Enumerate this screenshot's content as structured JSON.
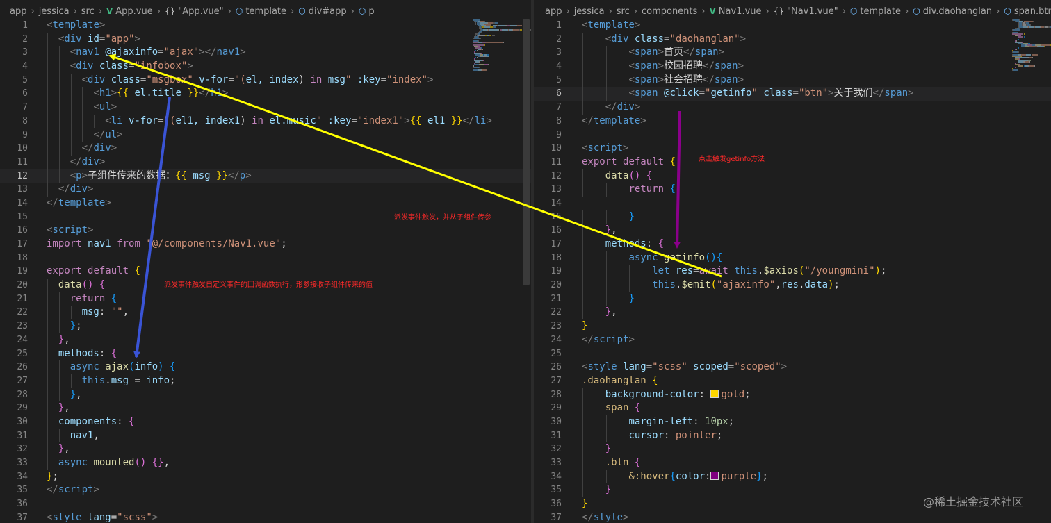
{
  "colors": {
    "editor_bg": "#1e1e1e",
    "tag": "#569cd6",
    "punctuation": "#808080",
    "attribute": "#9cdcfe",
    "string": "#ce9178",
    "keyword": "#c586c0",
    "function": "#dcdcaa",
    "selector": "#d7ba7d",
    "property": "#9cdcfe",
    "number": "#b5cea8",
    "brace_yellow": "#ffd700",
    "brace_purple": "#da70d6",
    "brace_blue": "#179fff",
    "annotation": "#ff2a2a",
    "arrow_yellow": "#ffff00",
    "arrow_blue": "#3a54d6",
    "arrow_purple": "#8b008b",
    "swatch_gold": "#ffd700",
    "swatch_purple": "#800080"
  },
  "left_breadcrumb": [
    {
      "label": "app",
      "icon": ""
    },
    {
      "label": "jessica",
      "icon": ""
    },
    {
      "label": "src",
      "icon": ""
    },
    {
      "label": "App.vue",
      "icon": "vue-file-icon"
    },
    {
      "label": "\"App.vue\"",
      "icon": "braces-icon"
    },
    {
      "label": "template",
      "icon": "cube-icon"
    },
    {
      "label": "div#app",
      "icon": "cube-icon"
    },
    {
      "label": "p",
      "icon": "cube-icon"
    }
  ],
  "right_breadcrumb": [
    {
      "label": "app",
      "icon": ""
    },
    {
      "label": "jessica",
      "icon": ""
    },
    {
      "label": "src",
      "icon": ""
    },
    {
      "label": "components",
      "icon": ""
    },
    {
      "label": "Nav1.vue",
      "icon": "vue-file-icon"
    },
    {
      "label": "\"Nav1.vue\"",
      "icon": "braces-icon"
    },
    {
      "label": "template",
      "icon": "cube-icon"
    },
    {
      "label": "div.daohanglan",
      "icon": "cube-icon"
    },
    {
      "label": "span.btn",
      "icon": "cube-icon"
    }
  ],
  "left_current_line": 12,
  "right_current_line": 6,
  "left_code": [
    [
      [
        "<",
        "p"
      ],
      [
        "template",
        "t"
      ],
      [
        ">",
        "p"
      ]
    ],
    [
      [
        "  ",
        "d"
      ],
      [
        "<",
        "p"
      ],
      [
        "div ",
        "t"
      ],
      [
        "id",
        "a"
      ],
      [
        "=",
        "d"
      ],
      [
        "\"app\"",
        "s"
      ],
      [
        ">",
        "p"
      ]
    ],
    [
      [
        "    ",
        "d"
      ],
      [
        "<",
        "p"
      ],
      [
        "nav1 ",
        "t"
      ],
      [
        "@ajaxinfo",
        "a"
      ],
      [
        "=",
        "d"
      ],
      [
        "\"ajax\"",
        "s"
      ],
      [
        "></",
        "p"
      ],
      [
        "nav1",
        "t"
      ],
      [
        ">",
        "p"
      ]
    ],
    [
      [
        "    ",
        "d"
      ],
      [
        "<",
        "p"
      ],
      [
        "div ",
        "t"
      ],
      [
        "class",
        "a"
      ],
      [
        "=",
        "d"
      ],
      [
        "\"infobox\"",
        "s"
      ],
      [
        ">",
        "p"
      ]
    ],
    [
      [
        "      ",
        "d"
      ],
      [
        "<",
        "p"
      ],
      [
        "div ",
        "t"
      ],
      [
        "class",
        "a"
      ],
      [
        "=",
        "d"
      ],
      [
        "\"msgbox\"",
        "s"
      ],
      [
        " ",
        "d"
      ],
      [
        "v-for",
        "a"
      ],
      [
        "=",
        "d"
      ],
      [
        "\"(",
        "s"
      ],
      [
        "el, ",
        "a"
      ],
      [
        "index",
        "a"
      ],
      [
        ") ",
        "d"
      ],
      [
        "in ",
        "k"
      ],
      [
        "msg",
        "a"
      ],
      [
        "\"",
        "s"
      ],
      [
        " :key",
        "a"
      ],
      [
        "=",
        "d"
      ],
      [
        "\"index\"",
        "s"
      ],
      [
        ">",
        "p"
      ]
    ],
    [
      [
        "        ",
        "d"
      ],
      [
        "<",
        "p"
      ],
      [
        "h1",
        "t"
      ],
      [
        ">",
        "p"
      ],
      [
        "{{ ",
        "y"
      ],
      [
        "el.title",
        "a"
      ],
      [
        " }}",
        "y"
      ],
      [
        "</",
        "p"
      ],
      [
        "h1",
        "t"
      ],
      [
        ">",
        "p"
      ]
    ],
    [
      [
        "        ",
        "d"
      ],
      [
        "<",
        "p"
      ],
      [
        "ul",
        "t"
      ],
      [
        ">",
        "p"
      ]
    ],
    [
      [
        "          ",
        "d"
      ],
      [
        "<",
        "p"
      ],
      [
        "li ",
        "t"
      ],
      [
        "v-for",
        "a"
      ],
      [
        "=",
        "d"
      ],
      [
        "\"(",
        "s"
      ],
      [
        "el1, index1",
        "a"
      ],
      [
        ") ",
        "d"
      ],
      [
        "in ",
        "k"
      ],
      [
        "el.music",
        "a"
      ],
      [
        "\"",
        "s"
      ],
      [
        " :key",
        "a"
      ],
      [
        "=",
        "d"
      ],
      [
        "\"index1\"",
        "s"
      ],
      [
        ">",
        "p"
      ],
      [
        "{{ ",
        "y"
      ],
      [
        "el1",
        "a"
      ],
      [
        " }}",
        "y"
      ],
      [
        "</",
        "p"
      ],
      [
        "li",
        "t"
      ],
      [
        ">",
        "p"
      ]
    ],
    [
      [
        "        ",
        "d"
      ],
      [
        "</",
        "p"
      ],
      [
        "ul",
        "t"
      ],
      [
        ">",
        "p"
      ]
    ],
    [
      [
        "      ",
        "d"
      ],
      [
        "</",
        "p"
      ],
      [
        "div",
        "t"
      ],
      [
        ">",
        "p"
      ]
    ],
    [
      [
        "    ",
        "d"
      ],
      [
        "</",
        "p"
      ],
      [
        "div",
        "t"
      ],
      [
        ">",
        "p"
      ]
    ],
    [
      [
        "    ",
        "d"
      ],
      [
        "<",
        "p"
      ],
      [
        "p",
        "t"
      ],
      [
        ">",
        "p"
      ],
      [
        "子组件传来的数据：",
        "d"
      ],
      [
        "{{ ",
        "y"
      ],
      [
        "msg",
        "a"
      ],
      [
        " }}",
        "y"
      ],
      [
        "</",
        "p"
      ],
      [
        "p",
        "t"
      ],
      [
        ">",
        "p"
      ]
    ],
    [
      [
        "  ",
        "d"
      ],
      [
        "</",
        "p"
      ],
      [
        "div",
        "t"
      ],
      [
        ">",
        "p"
      ]
    ],
    [
      [
        "</",
        "p"
      ],
      [
        "template",
        "t"
      ],
      [
        ">",
        "p"
      ]
    ],
    [],
    [
      [
        "<",
        "p"
      ],
      [
        "script",
        "t"
      ],
      [
        ">",
        "p"
      ]
    ],
    [
      [
        "import ",
        "k"
      ],
      [
        "nav1 ",
        "a"
      ],
      [
        "from ",
        "k"
      ],
      [
        "\"@/components/Nav1.vue\"",
        "s"
      ],
      [
        ";",
        "d"
      ]
    ],
    [],
    [
      [
        "export ",
        "k"
      ],
      [
        "default ",
        "k"
      ],
      [
        "{",
        "y"
      ]
    ],
    [
      [
        "  ",
        "d"
      ],
      [
        "data",
        "f"
      ],
      [
        "() ",
        "m"
      ],
      [
        "{",
        "m"
      ]
    ],
    [
      [
        "    ",
        "d"
      ],
      [
        "return ",
        "k"
      ],
      [
        "{",
        "b"
      ]
    ],
    [
      [
        "      ",
        "d"
      ],
      [
        "msg",
        "a"
      ],
      [
        ": ",
        "d"
      ],
      [
        "\"\"",
        "s"
      ],
      [
        ",",
        "d"
      ]
    ],
    [
      [
        "    ",
        "d"
      ],
      [
        "}",
        "b"
      ],
      [
        ";",
        "d"
      ]
    ],
    [
      [
        "  ",
        "d"
      ],
      [
        "}",
        "m"
      ],
      [
        ",",
        "d"
      ]
    ],
    [
      [
        "  ",
        "d"
      ],
      [
        "methods",
        "a"
      ],
      [
        ": ",
        "d"
      ],
      [
        "{",
        "m"
      ]
    ],
    [
      [
        "    ",
        "d"
      ],
      [
        "async ",
        "t"
      ],
      [
        "ajax",
        "f"
      ],
      [
        "(",
        "b"
      ],
      [
        "info",
        "a"
      ],
      [
        ") ",
        "b"
      ],
      [
        "{",
        "b"
      ]
    ],
    [
      [
        "      ",
        "d"
      ],
      [
        "this",
        "t"
      ],
      [
        ".",
        "d"
      ],
      [
        "msg",
        "a"
      ],
      [
        " = ",
        "d"
      ],
      [
        "info",
        "a"
      ],
      [
        ";",
        "d"
      ]
    ],
    [
      [
        "    ",
        "d"
      ],
      [
        "}",
        "b"
      ],
      [
        ",",
        "d"
      ]
    ],
    [
      [
        "  ",
        "d"
      ],
      [
        "}",
        "m"
      ],
      [
        ",",
        "d"
      ]
    ],
    [
      [
        "  ",
        "d"
      ],
      [
        "components",
        "a"
      ],
      [
        ": ",
        "d"
      ],
      [
        "{",
        "m"
      ]
    ],
    [
      [
        "    ",
        "d"
      ],
      [
        "nav1",
        "a"
      ],
      [
        ",",
        "d"
      ]
    ],
    [
      [
        "  ",
        "d"
      ],
      [
        "}",
        "m"
      ],
      [
        ",",
        "d"
      ]
    ],
    [
      [
        "  ",
        "d"
      ],
      [
        "async ",
        "t"
      ],
      [
        "mounted",
        "f"
      ],
      [
        "() ",
        "m"
      ],
      [
        "{}",
        "m"
      ],
      [
        ",",
        "d"
      ]
    ],
    [
      [
        "}",
        "y"
      ],
      [
        ";",
        "d"
      ]
    ],
    [
      [
        "</",
        "p"
      ],
      [
        "script",
        "t"
      ],
      [
        ">",
        "p"
      ]
    ],
    [],
    [
      [
        "<",
        "p"
      ],
      [
        "style ",
        "t"
      ],
      [
        "lang",
        "a"
      ],
      [
        "=",
        "d"
      ],
      [
        "\"scss\"",
        "s"
      ],
      [
        ">",
        "p"
      ]
    ]
  ],
  "right_code": [
    [
      [
        "<",
        "p"
      ],
      [
        "template",
        "t"
      ],
      [
        ">",
        "p"
      ]
    ],
    [
      [
        "    ",
        "d"
      ],
      [
        "<",
        "p"
      ],
      [
        "div ",
        "t"
      ],
      [
        "class",
        "a"
      ],
      [
        "=",
        "d"
      ],
      [
        "\"daohanglan\"",
        "s"
      ],
      [
        ">",
        "p"
      ]
    ],
    [
      [
        "        ",
        "d"
      ],
      [
        "<",
        "p"
      ],
      [
        "span",
        "t"
      ],
      [
        ">",
        "p"
      ],
      [
        "首页",
        "d"
      ],
      [
        "</",
        "p"
      ],
      [
        "span",
        "t"
      ],
      [
        ">",
        "p"
      ]
    ],
    [
      [
        "        ",
        "d"
      ],
      [
        "<",
        "p"
      ],
      [
        "span",
        "t"
      ],
      [
        ">",
        "p"
      ],
      [
        "校园招聘",
        "d"
      ],
      [
        "</",
        "p"
      ],
      [
        "span",
        "t"
      ],
      [
        ">",
        "p"
      ]
    ],
    [
      [
        "        ",
        "d"
      ],
      [
        "<",
        "p"
      ],
      [
        "span",
        "t"
      ],
      [
        ">",
        "p"
      ],
      [
        "社会招聘",
        "d"
      ],
      [
        "</",
        "p"
      ],
      [
        "span",
        "t"
      ],
      [
        ">",
        "p"
      ]
    ],
    [
      [
        "        ",
        "d"
      ],
      [
        "<",
        "p"
      ],
      [
        "span ",
        "t"
      ],
      [
        "@click",
        "a"
      ],
      [
        "=",
        "d"
      ],
      [
        "\"",
        "s"
      ],
      [
        "getinfo",
        "a"
      ],
      [
        "\"",
        "s"
      ],
      [
        " class",
        "a"
      ],
      [
        "=",
        "d"
      ],
      [
        "\"btn\"",
        "s"
      ],
      [
        ">",
        "p"
      ],
      [
        "关于我们",
        "d"
      ],
      [
        "</",
        "p"
      ],
      [
        "span",
        "t"
      ],
      [
        ">",
        "p"
      ]
    ],
    [
      [
        "    ",
        "d"
      ],
      [
        "</",
        "p"
      ],
      [
        "div",
        "t"
      ],
      [
        ">",
        "p"
      ]
    ],
    [
      [
        "</",
        "p"
      ],
      [
        "template",
        "t"
      ],
      [
        ">",
        "p"
      ]
    ],
    [],
    [
      [
        "<",
        "p"
      ],
      [
        "script",
        "t"
      ],
      [
        ">",
        "p"
      ]
    ],
    [
      [
        "export ",
        "k"
      ],
      [
        "default ",
        "k"
      ],
      [
        "{",
        "y"
      ]
    ],
    [
      [
        "    ",
        "d"
      ],
      [
        "data",
        "f"
      ],
      [
        "() ",
        "m"
      ],
      [
        "{",
        "m"
      ]
    ],
    [
      [
        "        ",
        "d"
      ],
      [
        "return ",
        "k"
      ],
      [
        "{",
        "b"
      ]
    ],
    [],
    [
      [
        "        ",
        "d"
      ],
      [
        "}",
        "b"
      ]
    ],
    [
      [
        "    ",
        "d"
      ],
      [
        "}",
        "m"
      ],
      [
        ",",
        "d"
      ]
    ],
    [
      [
        "    ",
        "d"
      ],
      [
        "methods",
        "a"
      ],
      [
        ": ",
        "d"
      ],
      [
        "{",
        "m"
      ]
    ],
    [
      [
        "        ",
        "d"
      ],
      [
        "async ",
        "t"
      ],
      [
        "getinfo",
        "f"
      ],
      [
        "()",
        "b"
      ],
      [
        "{",
        "b"
      ]
    ],
    [
      [
        "            ",
        "d"
      ],
      [
        "let ",
        "t"
      ],
      [
        "res",
        "a"
      ],
      [
        "=",
        "d"
      ],
      [
        "await ",
        "k"
      ],
      [
        "this",
        "t"
      ],
      [
        ".",
        "d"
      ],
      [
        "$axios",
        "f"
      ],
      [
        "(",
        "y"
      ],
      [
        "\"/youngmini\"",
        "s"
      ],
      [
        ")",
        "y"
      ],
      [
        ";",
        "d"
      ]
    ],
    [
      [
        "            ",
        "d"
      ],
      [
        "this",
        "t"
      ],
      [
        ".",
        "d"
      ],
      [
        "$emit",
        "f"
      ],
      [
        "(",
        "y"
      ],
      [
        "\"ajaxinfo\"",
        "s"
      ],
      [
        ",",
        "d"
      ],
      [
        "res",
        "a"
      ],
      [
        ".",
        "d"
      ],
      [
        "data",
        "a"
      ],
      [
        ")",
        "y"
      ],
      [
        ";",
        "d"
      ]
    ],
    [
      [
        "        ",
        "d"
      ],
      [
        "}",
        "b"
      ]
    ],
    [
      [
        "    ",
        "d"
      ],
      [
        "}",
        "m"
      ],
      [
        ",",
        "d"
      ]
    ],
    [
      [
        "}",
        "y"
      ]
    ],
    [
      [
        "</",
        "p"
      ],
      [
        "script",
        "t"
      ],
      [
        ">",
        "p"
      ]
    ],
    [],
    [
      [
        "<",
        "p"
      ],
      [
        "style ",
        "t"
      ],
      [
        "lang",
        "a"
      ],
      [
        "=",
        "d"
      ],
      [
        "\"scss\"",
        "s"
      ],
      [
        " scoped",
        "a"
      ],
      [
        "=",
        "d"
      ],
      [
        "\"scoped\"",
        "s"
      ],
      [
        ">",
        "p"
      ]
    ],
    [
      [
        ".daohanglan ",
        "e"
      ],
      [
        "{",
        "y"
      ]
    ],
    [
      [
        "    ",
        "d"
      ],
      [
        "background-color",
        "a"
      ],
      [
        ": ",
        "d"
      ],
      [
        "##SW_GOLD##",
        "w"
      ],
      [
        "gold",
        "s"
      ],
      [
        ";",
        "d"
      ]
    ],
    [
      [
        "    ",
        "d"
      ],
      [
        "span ",
        "e"
      ],
      [
        "{",
        "m"
      ]
    ],
    [
      [
        "        ",
        "d"
      ],
      [
        "margin-left",
        "a"
      ],
      [
        ": ",
        "d"
      ],
      [
        "10px",
        "n"
      ],
      [
        ";",
        "d"
      ]
    ],
    [
      [
        "        ",
        "d"
      ],
      [
        "cursor",
        "a"
      ],
      [
        ": ",
        "d"
      ],
      [
        "pointer",
        "s"
      ],
      [
        ";",
        "d"
      ]
    ],
    [
      [
        "    ",
        "d"
      ],
      [
        "}",
        "m"
      ]
    ],
    [
      [
        "    ",
        "d"
      ],
      [
        ".btn ",
        "e"
      ],
      [
        "{",
        "m"
      ]
    ],
    [
      [
        "        ",
        "d"
      ],
      [
        "&:hover",
        "e"
      ],
      [
        "{",
        "b"
      ],
      [
        "color",
        "a"
      ],
      [
        ":",
        "d"
      ],
      [
        "##SW_PURPLE##",
        "w"
      ],
      [
        "purple",
        "s"
      ],
      [
        "}",
        "b"
      ],
      [
        ";",
        "d"
      ]
    ],
    [
      [
        "    ",
        "d"
      ],
      [
        "}",
        "m"
      ]
    ],
    [
      [
        "}",
        "y"
      ]
    ],
    [
      [
        "</",
        "p"
      ],
      [
        "style",
        "t"
      ],
      [
        ">",
        "p"
      ]
    ]
  ],
  "annotations": {
    "right_pane_emit": "派发事件触发，并从子组件传参",
    "left_pane_callback": "派发事件触发自定义事件的回调函数执行，形参接收子组件传来的值",
    "right_pane_click": "点击触发getinfo方法"
  },
  "watermark": "@稀土掘金技术社区"
}
